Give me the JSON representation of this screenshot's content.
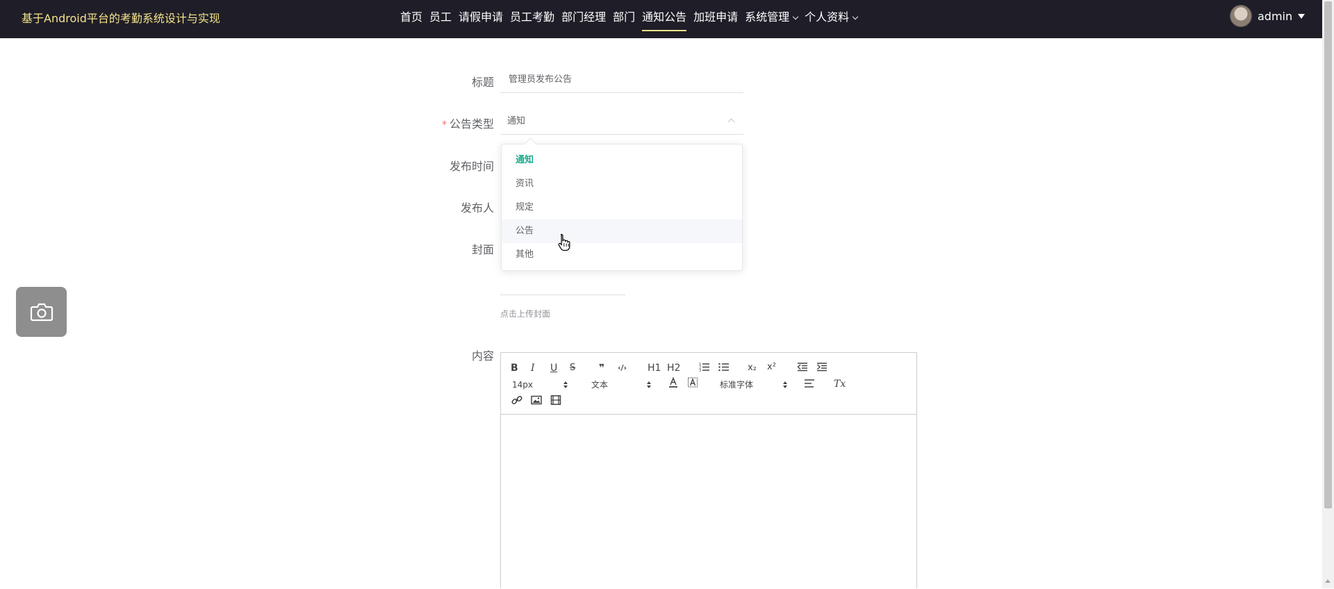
{
  "header": {
    "brand": "基于Android平台的考勤系统设计与实现",
    "nav": [
      {
        "label": "首页",
        "active": false,
        "has_caret": false
      },
      {
        "label": "员工",
        "active": false,
        "has_caret": false
      },
      {
        "label": "请假申请",
        "active": false,
        "has_caret": false
      },
      {
        "label": "员工考勤",
        "active": false,
        "has_caret": false
      },
      {
        "label": "部门经理",
        "active": false,
        "has_caret": false
      },
      {
        "label": "部门",
        "active": false,
        "has_caret": false
      },
      {
        "label": "通知公告",
        "active": true,
        "has_caret": false
      },
      {
        "label": "加班申请",
        "active": false,
        "has_caret": false
      },
      {
        "label": "系统管理",
        "active": false,
        "has_caret": true
      },
      {
        "label": "个人资料",
        "active": false,
        "has_caret": true
      }
    ],
    "user": {
      "name": "admin"
    }
  },
  "form": {
    "title_label": "标题",
    "title_value": "管理员发布公告",
    "type_required_mark": "*",
    "type_label": "公告类型",
    "type_value": "通知",
    "publish_time_label": "发布时间",
    "publisher_label": "发布人",
    "cover_label": "封面",
    "cover_tip": "点击上传封面",
    "content_label": "内容"
  },
  "type_dropdown": {
    "options": [
      "通知",
      "资讯",
      "规定",
      "公告",
      "其他"
    ],
    "selected_index": 0,
    "hover_index": 3
  },
  "editor_toolbar": {
    "bold": "B",
    "italic": "I",
    "underline": "U",
    "strike": "S",
    "quote": "❞",
    "code": "‹/›",
    "h1": "H1",
    "h2": "H2",
    "subscript": "x₂",
    "superscript": "x²",
    "size_select": "14px",
    "block_select": "文本",
    "font_select": "标准字体",
    "clear_format": "Tx"
  },
  "colors": {
    "topbar_bg": "#1f1e28",
    "brand_color": "#f5e38a",
    "accent_green": "#1aac8c",
    "required_red": "#f56c6c"
  }
}
